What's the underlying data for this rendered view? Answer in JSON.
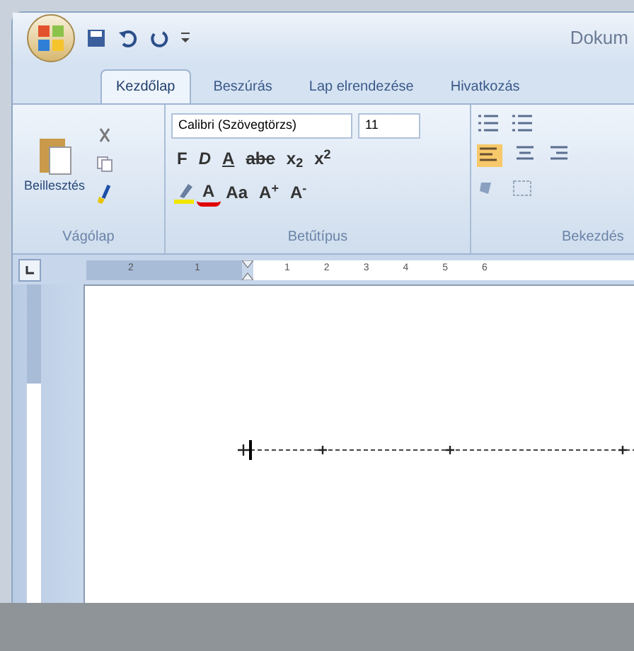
{
  "window": {
    "title": "Dokum"
  },
  "tabs": [
    {
      "label": "Kezdőlap",
      "selected": true
    },
    {
      "label": "Beszúrás",
      "selected": false
    },
    {
      "label": "Lap elrendezése",
      "selected": false
    },
    {
      "label": "Hivatkozás",
      "selected": false
    }
  ],
  "clipboard": {
    "paste_label": "Beillesztés",
    "group_label": "Vágólap"
  },
  "font": {
    "name": "Calibri (Szövegtörzs)",
    "size": "11",
    "row_1": [
      "F",
      "D",
      "A",
      "abe",
      "x$_{2}$",
      "x$^{2}$"
    ],
    "row_2": [
      "A",
      "Aa",
      "A$^{+}$",
      "A$^{-}$"
    ],
    "group_label": "Betűtípus"
  },
  "paragraph": {
    "group_label": "Bekezdés"
  },
  "ruler": {
    "left_labels": [
      "2",
      "1"
    ],
    "right_labels": [
      "1",
      "2",
      "3",
      "4",
      "5",
      "6"
    ]
  }
}
